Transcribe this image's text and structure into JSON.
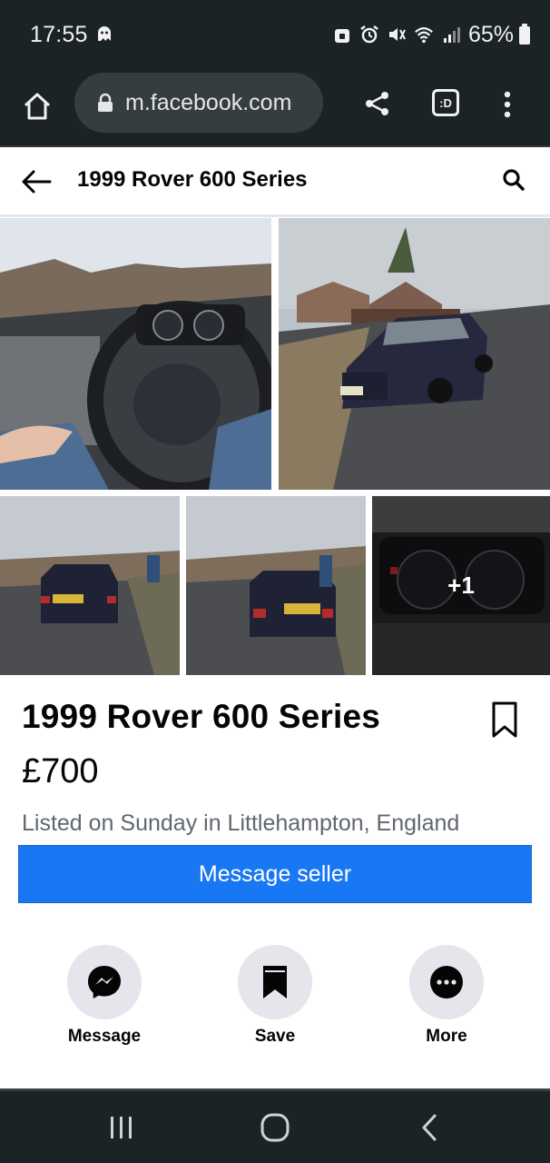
{
  "status_bar": {
    "time": "17:55",
    "battery": "65%",
    "icons": [
      "ghost-icon",
      "lock-app-icon",
      "alarm-icon",
      "mute-icon",
      "wifi-icon",
      "signal-icon",
      "battery-icon"
    ]
  },
  "browser": {
    "url": "m.facebook.com",
    "tabs_label": ":D"
  },
  "header": {
    "title": "1999 Rover 600 Series"
  },
  "photos": {
    "more_count": "+1"
  },
  "listing": {
    "title": "1999 Rover 600 Series",
    "price": "£700",
    "listed": "Listed on Sunday in Littlehampton, England",
    "message_button": "Message seller"
  },
  "actions": [
    {
      "label": "Message",
      "icon": "messenger-icon"
    },
    {
      "label": "Save",
      "icon": "bookmark-icon"
    },
    {
      "label": "More",
      "icon": "more-icon"
    }
  ],
  "colors": {
    "primary": "#1877f2",
    "system_bar": "#1c2327",
    "action_circle": "#e4e6eb"
  }
}
